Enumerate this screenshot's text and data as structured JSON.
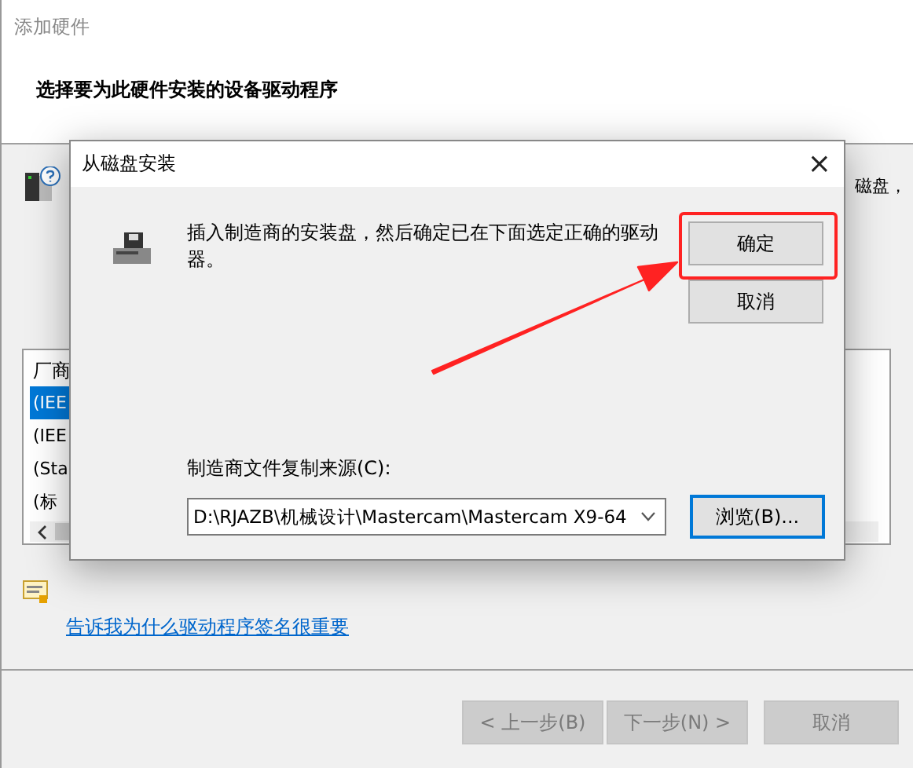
{
  "window": {
    "title": "添加硬件",
    "heading": "选择要为此硬件安装的设备驱动程序",
    "note_tail": "磁盘，"
  },
  "list": {
    "header": "厂商",
    "rows": [
      {
        "label": "(IEE",
        "selected": true
      },
      {
        "label": "(IEE",
        "selected": false
      },
      {
        "label": "(Sta",
        "selected": false
      },
      {
        "label": "(标",
        "selected": false
      }
    ]
  },
  "link": "告诉我为什么驱动程序签名很重要",
  "wizard_buttons": [
    {
      "label": "< 上一步(B)",
      "disabled": true
    },
    {
      "label": "下一步(N) >",
      "disabled": true
    },
    {
      "label": "取消",
      "disabled": true
    }
  ],
  "dialog": {
    "title": "从磁盘安装",
    "close": "×",
    "message": "插入制造商的安装盘，然后确定已在下面选定正确的驱动器。",
    "buttons": [
      {
        "label": "确定",
        "focused": false,
        "highlighted": true
      },
      {
        "label": "取消",
        "focused": false,
        "highlighted": false
      }
    ],
    "source_label": "制造商文件复制来源(C):",
    "source_value": "D:\\RJAZB\\机械设计\\Mastercam\\Mastercam X9-64",
    "browse": {
      "label": "浏览(B)...",
      "focused": true
    }
  }
}
